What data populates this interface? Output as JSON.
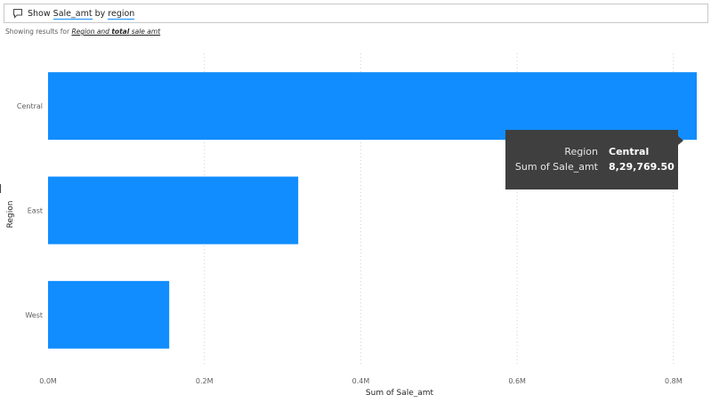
{
  "qa": {
    "icon": "speech-bubble-icon",
    "show": "Show",
    "field": "Sale_amt",
    "by": "by",
    "group": "region"
  },
  "showing": {
    "prefix": "Showing results for",
    "link_a": "Region and",
    "link_b": "total",
    "link_c": "sale amt"
  },
  "tooltip": {
    "label1": "Region",
    "value1": "Central",
    "label2": "Sum of Sale_amt",
    "value2": "8,29,769.50"
  },
  "chart_data": {
    "type": "bar",
    "orientation": "horizontal",
    "categories": [
      "Central",
      "East",
      "West"
    ],
    "values": [
      829769.5,
      320000,
      155000
    ],
    "ticks": [
      0,
      200000,
      400000,
      600000,
      800000
    ],
    "tick_labels": [
      "0.0M",
      "0.2M",
      "0.4M",
      "0.6M",
      "0.8M"
    ],
    "xlim": [
      0,
      829769.5
    ],
    "xlabel": "Sum of Sale_amt",
    "ylabel": "Region",
    "bar_color": "#118dff",
    "grid": "vertical dotted"
  }
}
